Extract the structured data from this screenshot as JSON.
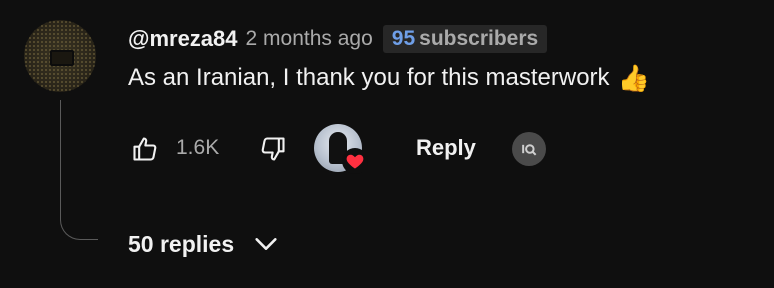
{
  "comment": {
    "author": "@mreza84",
    "time": "2 months ago",
    "subscriber_badge": {
      "count": "95",
      "label": "subscribers",
      "count_color": "#6f9fe8"
    },
    "text": "As an Iranian, I thank you for this masterwork",
    "emoji": "👍",
    "avatar_icon": "avatar-icon"
  },
  "actions": {
    "like_icon": "thumbs-up-icon",
    "like_count": "1.6K",
    "dislike_icon": "thumbs-down-icon",
    "creator_heart_icon": "creator-heart-icon",
    "heart_color": "#ff3040",
    "reply_label": "Reply",
    "extension_icon": "extension-icon"
  },
  "replies": {
    "label": "50 replies",
    "toggle_icon": "chevron-down-icon"
  }
}
